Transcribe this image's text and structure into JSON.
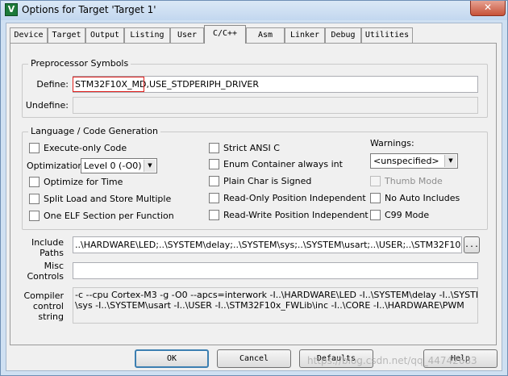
{
  "window": {
    "app_icon": "keil-uvision-icon",
    "title": "Options for Target 'Target 1'",
    "close_glyph": "✕"
  },
  "tabs": [
    "Device",
    "Target",
    "Output",
    "Listing",
    "User",
    "C/C++",
    "Asm",
    "Linker",
    "Debug",
    "Utilities"
  ],
  "active_tab": "C/C++",
  "preprocessor": {
    "legend": "Preprocessor Symbols",
    "define_label": "Define:",
    "define_value": "STM32F10X_MD,USE_STDPERIPH_DRIVER",
    "undefine_label": "Undefine:",
    "undefine_value": ""
  },
  "language": {
    "legend": "Language / Code Generation",
    "execute_only": "Execute-only Code",
    "optimization_label": "Optimization:",
    "optimization_value": "Level 0 (-O0)",
    "optimize_time": "Optimize for Time",
    "split_load": "Split Load and Store Multiple",
    "one_elf": "One ELF Section per Function",
    "strict_ansi": "Strict ANSI C",
    "enum_container": "Enum Container always int",
    "plain_char": "Plain Char is Signed",
    "ro_position": "Read-Only Position Independent",
    "rw_position": "Read-Write Position Independent",
    "warnings_label": "Warnings:",
    "warnings_value": "<unspecified>",
    "thumb_mode": "Thumb Mode",
    "no_auto_includes": "No Auto Includes",
    "c99_mode": "C99 Mode"
  },
  "include": {
    "label_line1": "Include",
    "label_line2": "Paths",
    "value": "..\\HARDWARE\\LED;..\\SYSTEM\\delay;..\\SYSTEM\\sys;..\\SYSTEM\\usart;..\\USER;..\\STM32F10x_F",
    "browse_label": "..."
  },
  "misc": {
    "label_line1": "Misc",
    "label_line2": "Controls",
    "value": ""
  },
  "compiler": {
    "label_line1": "Compiler",
    "label_line2": "control",
    "label_line3": "string",
    "line1": "-c --cpu Cortex-M3 -g -O0 --apcs=interwork -I..\\HARDWARE\\LED -I..\\SYSTEM\\delay -I..\\SYSTEM",
    "line2": "\\sys -I..\\SYSTEM\\usart -I..\\USER -I..\\STM32F10x_FWLib\\inc -I..\\CORE -I..\\HARDWARE\\PWM"
  },
  "buttons": {
    "ok": "OK",
    "cancel": "Cancel",
    "defaults": "Defaults",
    "help": "Help"
  },
  "watermark": "https://blog.csdn.net/qq_44742683"
}
